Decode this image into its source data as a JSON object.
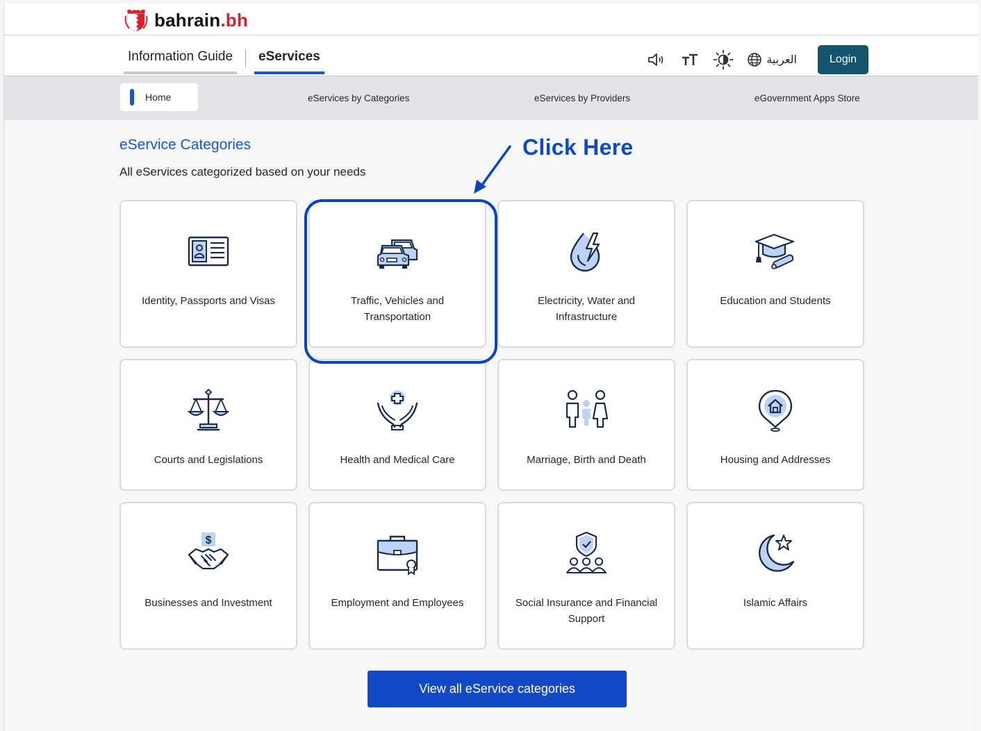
{
  "brand": {
    "name": "bahrain",
    "tld": ".bh"
  },
  "nav": {
    "tabs": [
      {
        "label": "Information Guide"
      },
      {
        "label": "eServices"
      }
    ]
  },
  "tools": {
    "language_label": "العربية",
    "login_label": "Login"
  },
  "subnav": {
    "home_label": "Home",
    "links": [
      {
        "label": "eServices by Categories"
      },
      {
        "label": "eServices by Providers"
      },
      {
        "label": "eGovernment Apps Store"
      }
    ]
  },
  "section": {
    "title": "eService Categories",
    "subtitle": "All eServices categorized based on your needs"
  },
  "annotation": {
    "text": "Click Here",
    "target": "Traffic, Vehicles and Transportation"
  },
  "categories": [
    {
      "label": "Identity, Passports and Visas",
      "icon": "id-card-icon"
    },
    {
      "label": "Traffic, Vehicles and Transportation",
      "icon": "cars-icon"
    },
    {
      "label": "Electricity, Water and Infrastructure",
      "icon": "water-electricity-icon"
    },
    {
      "label": "Education and Students",
      "icon": "graduation-cap-icon"
    },
    {
      "label": "Courts and Legislations",
      "icon": "scales-icon"
    },
    {
      "label": "Health and Medical Care",
      "icon": "medical-hands-icon"
    },
    {
      "label": "Marriage, Birth and Death",
      "icon": "family-icon"
    },
    {
      "label": "Housing and Addresses",
      "icon": "house-pin-icon"
    },
    {
      "label": "Businesses and Investment",
      "icon": "handshake-dollar-icon"
    },
    {
      "label": "Employment and Employees",
      "icon": "briefcase-icon"
    },
    {
      "label": "Social Insurance and Financial Support",
      "icon": "shield-people-icon"
    },
    {
      "label": "Islamic Affairs",
      "icon": "crescent-star-icon"
    }
  ],
  "view_all_label": "View all eService categories",
  "colors": {
    "primary": "#1558c7",
    "login": "#14546e",
    "annotation": "#0c45b9",
    "icon_fill": "#bcd3f5",
    "icon_stroke": "#1a2a4a"
  }
}
